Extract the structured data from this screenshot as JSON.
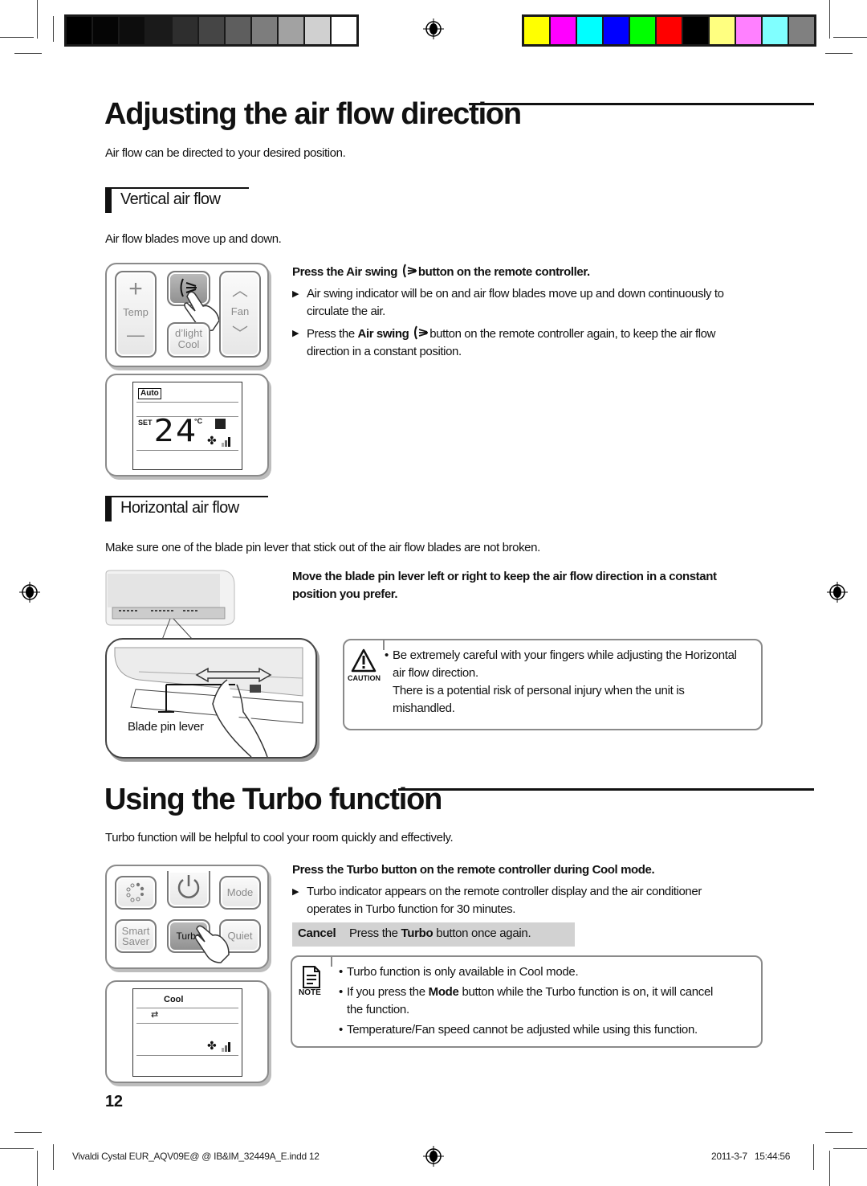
{
  "print_marks": {
    "grayscale_swatches": [
      "#000000",
      "#050505",
      "#0d0d0d",
      "#1a1a1a",
      "#2e2e2e",
      "#454545",
      "#5e5e5e",
      "#7d7d7d",
      "#a2a2a2",
      "#d0d0d0",
      "#ffffff"
    ],
    "color_swatches": [
      "#ffff00",
      "#ff00ff",
      "#00ffff",
      "#0000ff",
      "#00ff00",
      "#ff0000",
      "#000000",
      "#ffff80",
      "#ff80ff",
      "#80ffff",
      "#808080"
    ]
  },
  "section1": {
    "title": "Adjusting the air flow direction",
    "intro": "Air flow can be directed to your desired position.",
    "vertical": {
      "heading": "Vertical air flow",
      "intro": "Air flow blades move up and down.",
      "instruction_pre": "Press the ",
      "instruction_bold": "Air swing",
      "instruction_post": "button on the remote controller.",
      "bullets": [
        {
          "pre": "Air swing indicator will be on and air flow blades move up and down continuously to",
          "line2": "circulate the air."
        },
        {
          "pre": "Press the ",
          "bold": "Air swing",
          "post": "button on the remote controller again, to keep the air flow",
          "line2": "direction in a constant position."
        }
      ],
      "remote": {
        "temp_plus": "+",
        "temp_label": "Temp",
        "temp_minus": "—",
        "dlight_line1": "d’light",
        "dlight_line2": "Cool",
        "fan_label": "Fan",
        "air_swing_icon": "air-swing-icon"
      },
      "display": {
        "mode": "Auto",
        "set_label": "SET",
        "temperature": "24",
        "unit": "°C",
        "fan_level": 3
      }
    },
    "horizontal": {
      "heading": "Horizontal air flow",
      "intro": "Make sure one of the blade pin lever that stick out of the air flow blades are not broken.",
      "instruction_line1": "Move the blade pin lever left or right to keep the air flow direction in a constant",
      "instruction_line2": "position you prefer.",
      "illustration_label": "Blade pin lever",
      "caution": {
        "label": "CAUTION",
        "lines": [
          "Be extremely careful with your fingers while adjusting the Horizontal",
          "air flow direction.",
          "There is a potential risk of personal injury when the unit is",
          "mishandled."
        ]
      }
    }
  },
  "section2": {
    "title": "Using the Turbo function",
    "intro": "Turbo function will be helpful to cool your room quickly and effectively.",
    "instruction_pre": "Press the ",
    "instruction_bold": "Turbo",
    "instruction_post": " button on the remote controller during Cool mode.",
    "bullet_line1": "Turbo indicator appears on the remote controller display and the air conditioner",
    "bullet_line2": "operates in Turbo function for 30 minutes.",
    "cancel": {
      "label": "Cancel",
      "text_pre": "Press the ",
      "text_bold": "Turbo",
      "text_post": " button once again."
    },
    "remote": {
      "power_icon": "power-icon",
      "mode": "Mode",
      "smart_line1": "Smart",
      "smart_line2": "Saver",
      "turbo": "Turbo",
      "quiet": "Quiet"
    },
    "display": {
      "mode": "Cool",
      "fan_level": 3
    },
    "note": {
      "label": "NOTE",
      "items": [
        {
          "text": "Turbo function is only available in Cool mode."
        },
        {
          "pre": "If you press the ",
          "bold": "Mode",
          "post": " button while the Turbo function is on, it will cancel",
          "line2": "the function."
        },
        {
          "text": "Temperature/Fan speed cannot be adjusted while using this function."
        }
      ]
    }
  },
  "page_number": "12",
  "footer": {
    "file": "Vivaldi Cystal EUR_AQV09E@ @ IB&IM_32449A_E.indd   12",
    "date": "2011-3-7",
    "time": "15:44:56"
  }
}
